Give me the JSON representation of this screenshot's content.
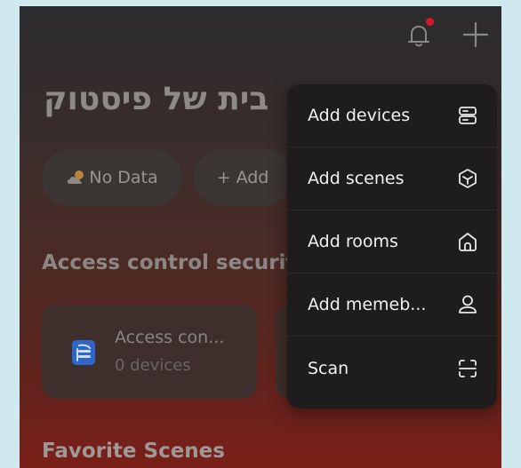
{
  "header": {
    "bell_icon": "bell-icon",
    "bell_badge_color": "#d4192b",
    "add_icon": "plus-icon"
  },
  "home": {
    "title": "בית של פיסטוק"
  },
  "chips": {
    "weather_label": "No Data",
    "weather_icon": "cloud-sun-icon",
    "add_label": "+ Add"
  },
  "sections": {
    "access_title": "Access control security",
    "favorites_title": "Favorite Scenes"
  },
  "device_card": {
    "name": "Access con...",
    "count": "0 devices",
    "icon_color": "#2e67c9"
  },
  "menu": {
    "items": [
      {
        "label": "Add devices",
        "icon": "device-icon"
      },
      {
        "label": "Add scenes",
        "icon": "scene-cube-icon"
      },
      {
        "label": "Add rooms",
        "icon": "home-icon"
      },
      {
        "label": "Add memeb...",
        "icon": "person-icon"
      },
      {
        "label": "Scan",
        "icon": "scan-icon"
      }
    ]
  }
}
